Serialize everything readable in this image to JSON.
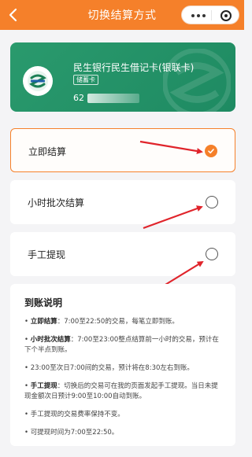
{
  "header": {
    "title": "切换结算方式",
    "back_icon": "chevron-left-icon",
    "capsule_icons": [
      "more-dots-icon",
      "close-target-icon"
    ],
    "accent": "#f5802a"
  },
  "card": {
    "bank_name": "民生银行民生借记卡(银联卡)",
    "badge": "储蓄卡",
    "number_prefix": "62",
    "color": "#2a9a6d"
  },
  "options": [
    {
      "label": "立即结算",
      "selected": true
    },
    {
      "label": "小时批次结算",
      "selected": false
    },
    {
      "label": "手工提现",
      "selected": false
    }
  ],
  "info": {
    "title": "到账说明",
    "items": [
      {
        "bullet": "•",
        "bold": "立即结算",
        "text": "：7:00至22:50的交易，每笔立即到账。"
      },
      {
        "bullet": "•",
        "bold": "小时批次结算",
        "text": "：7:00至23:00整点结算前一小时的交易，预计在下个半点到账。"
      },
      {
        "bullet": "•",
        "bold": "",
        "text": "23:00至次日7:00间的交易，预计将在8:30左右到账。"
      },
      {
        "bullet": "•",
        "bold": "手工提现",
        "text": "：切换后的交易可在我的页面发起手工提现。当日未提现金额次日预计9:00至10:00自动到账。"
      },
      {
        "bullet": "•",
        "bold": "",
        "text": "手工提现的交易费率保持不变。"
      },
      {
        "bullet": "•",
        "bold": "",
        "text": "可提现时间为7:00至22:50。"
      }
    ]
  }
}
